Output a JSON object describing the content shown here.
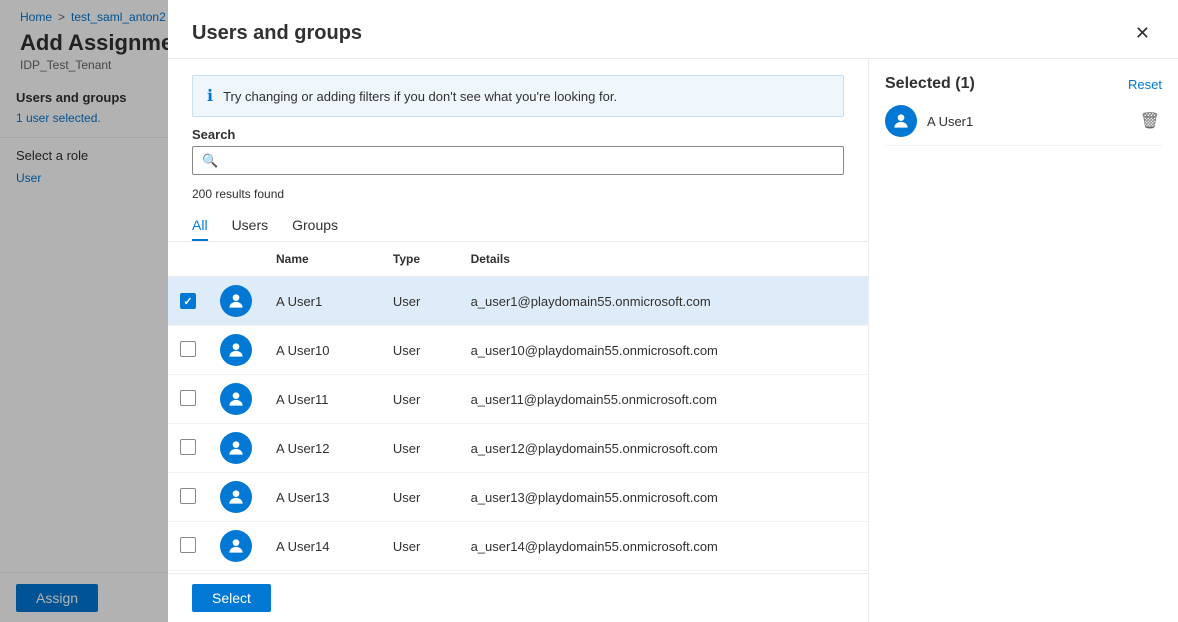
{
  "breadcrumb": {
    "home": "Home",
    "separator": ">",
    "test": "test_saml_anton2"
  },
  "page": {
    "title": "Add Assignment",
    "tenant": "IDP_Test_Tenant"
  },
  "sidebar": {
    "section1_label": "Users and groups",
    "section1_sub": "1 user selected.",
    "section2_label": "Select a role",
    "section2_value": "User"
  },
  "bottom_bar": {
    "assign_label": "Assign"
  },
  "modal": {
    "title": "Users and groups",
    "close_icon": "✕",
    "info_text": "Try changing or adding filters if you don't see what you're looking for.",
    "search_label": "Search",
    "search_placeholder": "",
    "results_count": "200 results found",
    "tabs": [
      {
        "id": "all",
        "label": "All",
        "active": true
      },
      {
        "id": "users",
        "label": "Users",
        "active": false
      },
      {
        "id": "groups",
        "label": "Groups",
        "active": false
      }
    ],
    "table": {
      "columns": [
        "",
        "",
        "Name",
        "Type",
        "Details"
      ],
      "rows": [
        {
          "checked": true,
          "name": "A User1",
          "type": "User",
          "details": "a_user1@playdomain55.onmicrosoft.com"
        },
        {
          "checked": false,
          "name": "A User10",
          "type": "User",
          "details": "a_user10@playdomain55.onmicrosoft.com"
        },
        {
          "checked": false,
          "name": "A User11",
          "type": "User",
          "details": "a_user11@playdomain55.onmicrosoft.com"
        },
        {
          "checked": false,
          "name": "A User12",
          "type": "User",
          "details": "a_user12@playdomain55.onmicrosoft.com"
        },
        {
          "checked": false,
          "name": "A User13",
          "type": "User",
          "details": "a_user13@playdomain55.onmicrosoft.com"
        },
        {
          "checked": false,
          "name": "A User14",
          "type": "User",
          "details": "a_user14@playdomain55.onmicrosoft.com"
        }
      ]
    },
    "select_label": "Select",
    "selected_panel": {
      "title": "Selected (1)",
      "reset_label": "Reset",
      "items": [
        {
          "name": "A User1"
        }
      ]
    }
  }
}
